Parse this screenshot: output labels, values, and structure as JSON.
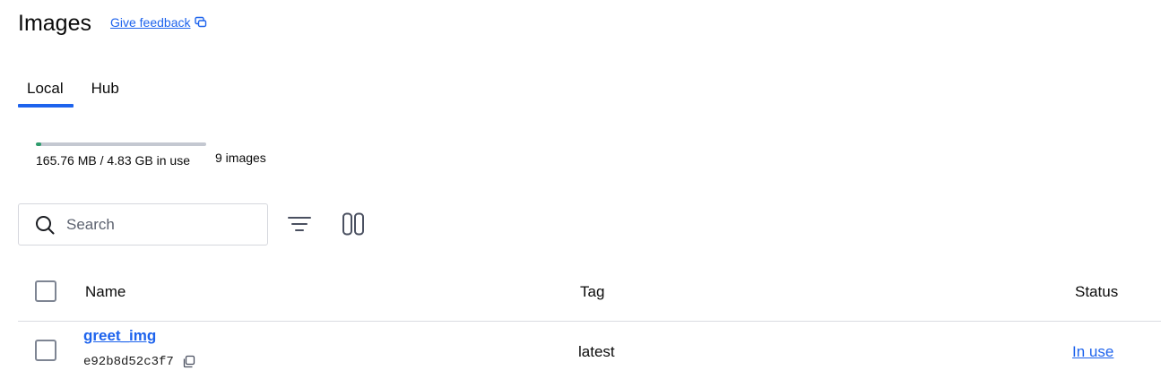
{
  "header": {
    "title": "Images",
    "feedback_label": "Give feedback"
  },
  "tabs": [
    {
      "label": "Local",
      "active": true
    },
    {
      "label": "Hub",
      "active": false
    }
  ],
  "usage": {
    "text": "165.76 MB / 4.83 GB in use",
    "fraction_used": 0.034,
    "count_text": "9 images",
    "fill_color": "#2e9c6c"
  },
  "search": {
    "placeholder": "Search"
  },
  "toolbar": {
    "filter_icon": "filter-icon",
    "columns_icon": "columns-icon"
  },
  "table": {
    "columns": [
      "Name",
      "Tag",
      "Status"
    ],
    "rows": [
      {
        "name": "greet_img",
        "id": "e92b8d52c3f7",
        "tag": "latest",
        "status": "In use"
      }
    ]
  },
  "colors": {
    "accent": "#1d63ed"
  }
}
